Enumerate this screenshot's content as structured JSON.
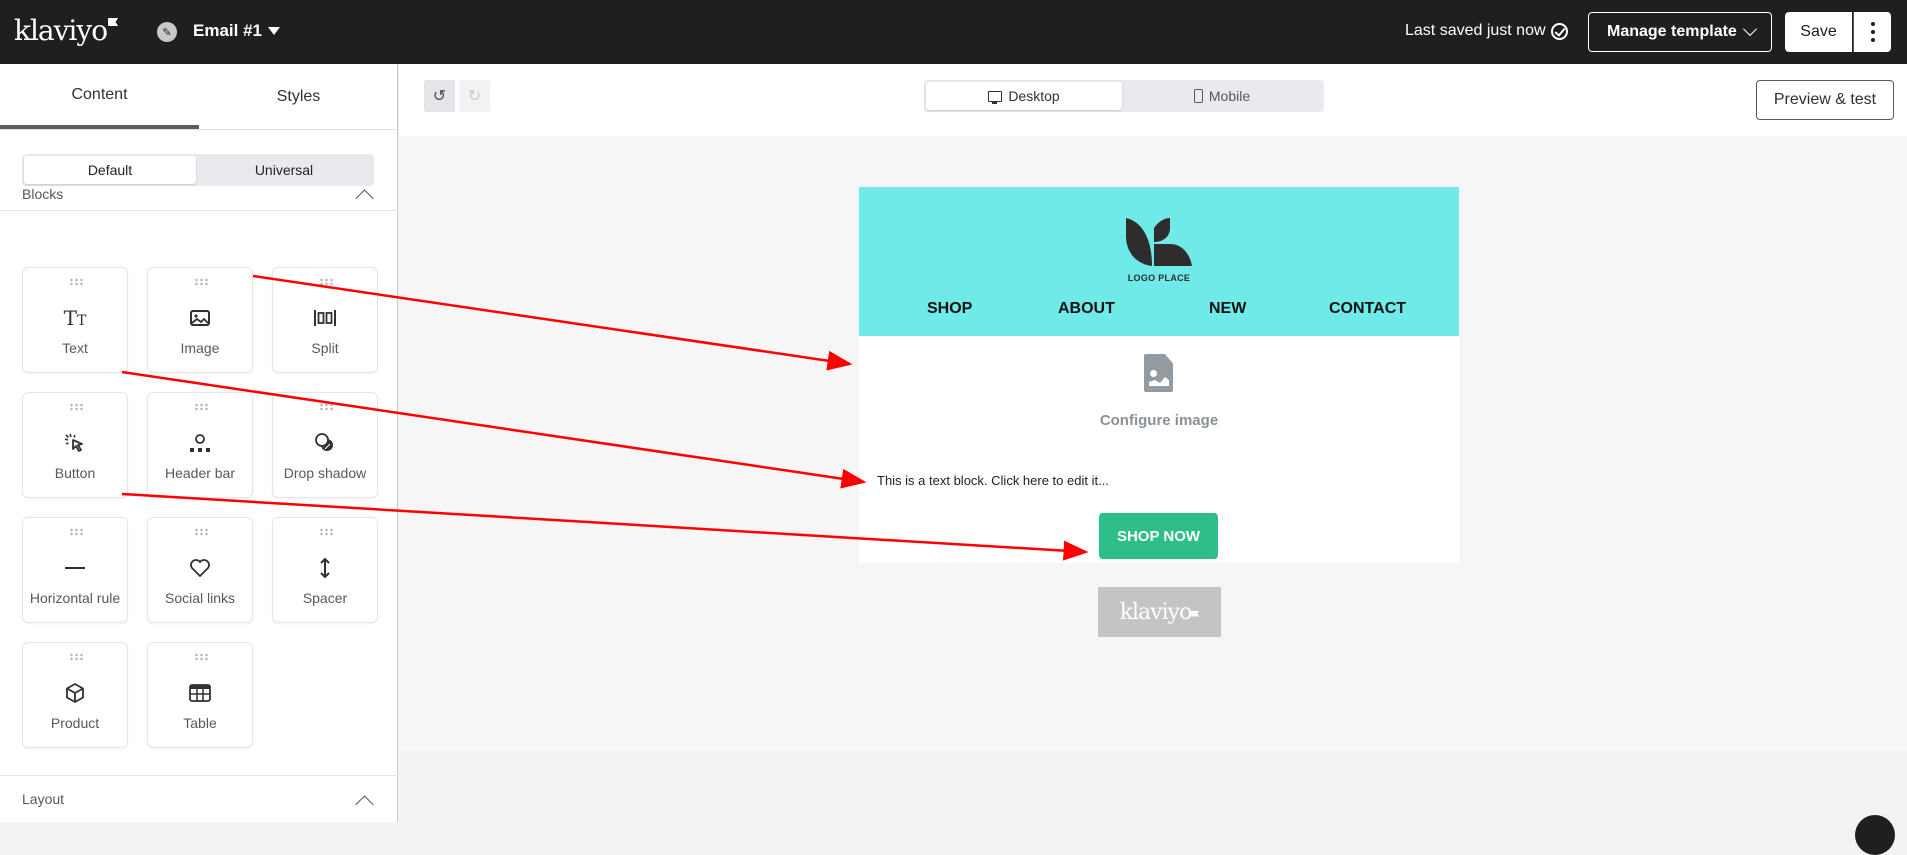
{
  "topbar": {
    "brand": "klaviyo",
    "email_name": "Email #1",
    "save_status": "Last saved just now",
    "manage_template_label": "Manage template",
    "save_label": "Save"
  },
  "sidebar": {
    "tabs": [
      {
        "label": "Content",
        "active": true
      },
      {
        "label": "Styles",
        "active": false
      }
    ],
    "segment": [
      {
        "label": "Default",
        "selected": true
      },
      {
        "label": "Universal",
        "selected": false
      }
    ],
    "blocks_title": "Blocks",
    "blocks": [
      {
        "label": "Text",
        "icon": "text-icon"
      },
      {
        "label": "Image",
        "icon": "image-icon"
      },
      {
        "label": "Split",
        "icon": "split-icon"
      },
      {
        "label": "Button",
        "icon": "button-icon"
      },
      {
        "label": "Header bar",
        "icon": "header-bar-icon"
      },
      {
        "label": "Drop shadow",
        "icon": "drop-shadow-icon"
      },
      {
        "label": "Horizontal rule",
        "icon": "horizontal-rule-icon"
      },
      {
        "label": "Social links",
        "icon": "heart-icon"
      },
      {
        "label": "Spacer",
        "icon": "spacer-icon"
      },
      {
        "label": "Product",
        "icon": "product-icon"
      },
      {
        "label": "Table",
        "icon": "table-icon"
      }
    ],
    "layout_title": "Layout"
  },
  "toolbar": {
    "views": [
      {
        "label": "Desktop",
        "selected": true
      },
      {
        "label": "Mobile",
        "selected": false
      }
    ],
    "preview_label": "Preview & test"
  },
  "email": {
    "header_bg": "#70e9e9",
    "logo_text": "LOGO PLACE",
    "nav": [
      "SHOP",
      "ABOUT",
      "NEW",
      "CONTACT"
    ],
    "image_placeholder": "Configure image",
    "text_block": "This is a text block. Click here to edit it...",
    "cta_label": "SHOP NOW",
    "cta_color": "#2ebf88",
    "footer_brand": "klaviyo"
  },
  "annotations": {
    "arrow_color": "#ff0000"
  }
}
